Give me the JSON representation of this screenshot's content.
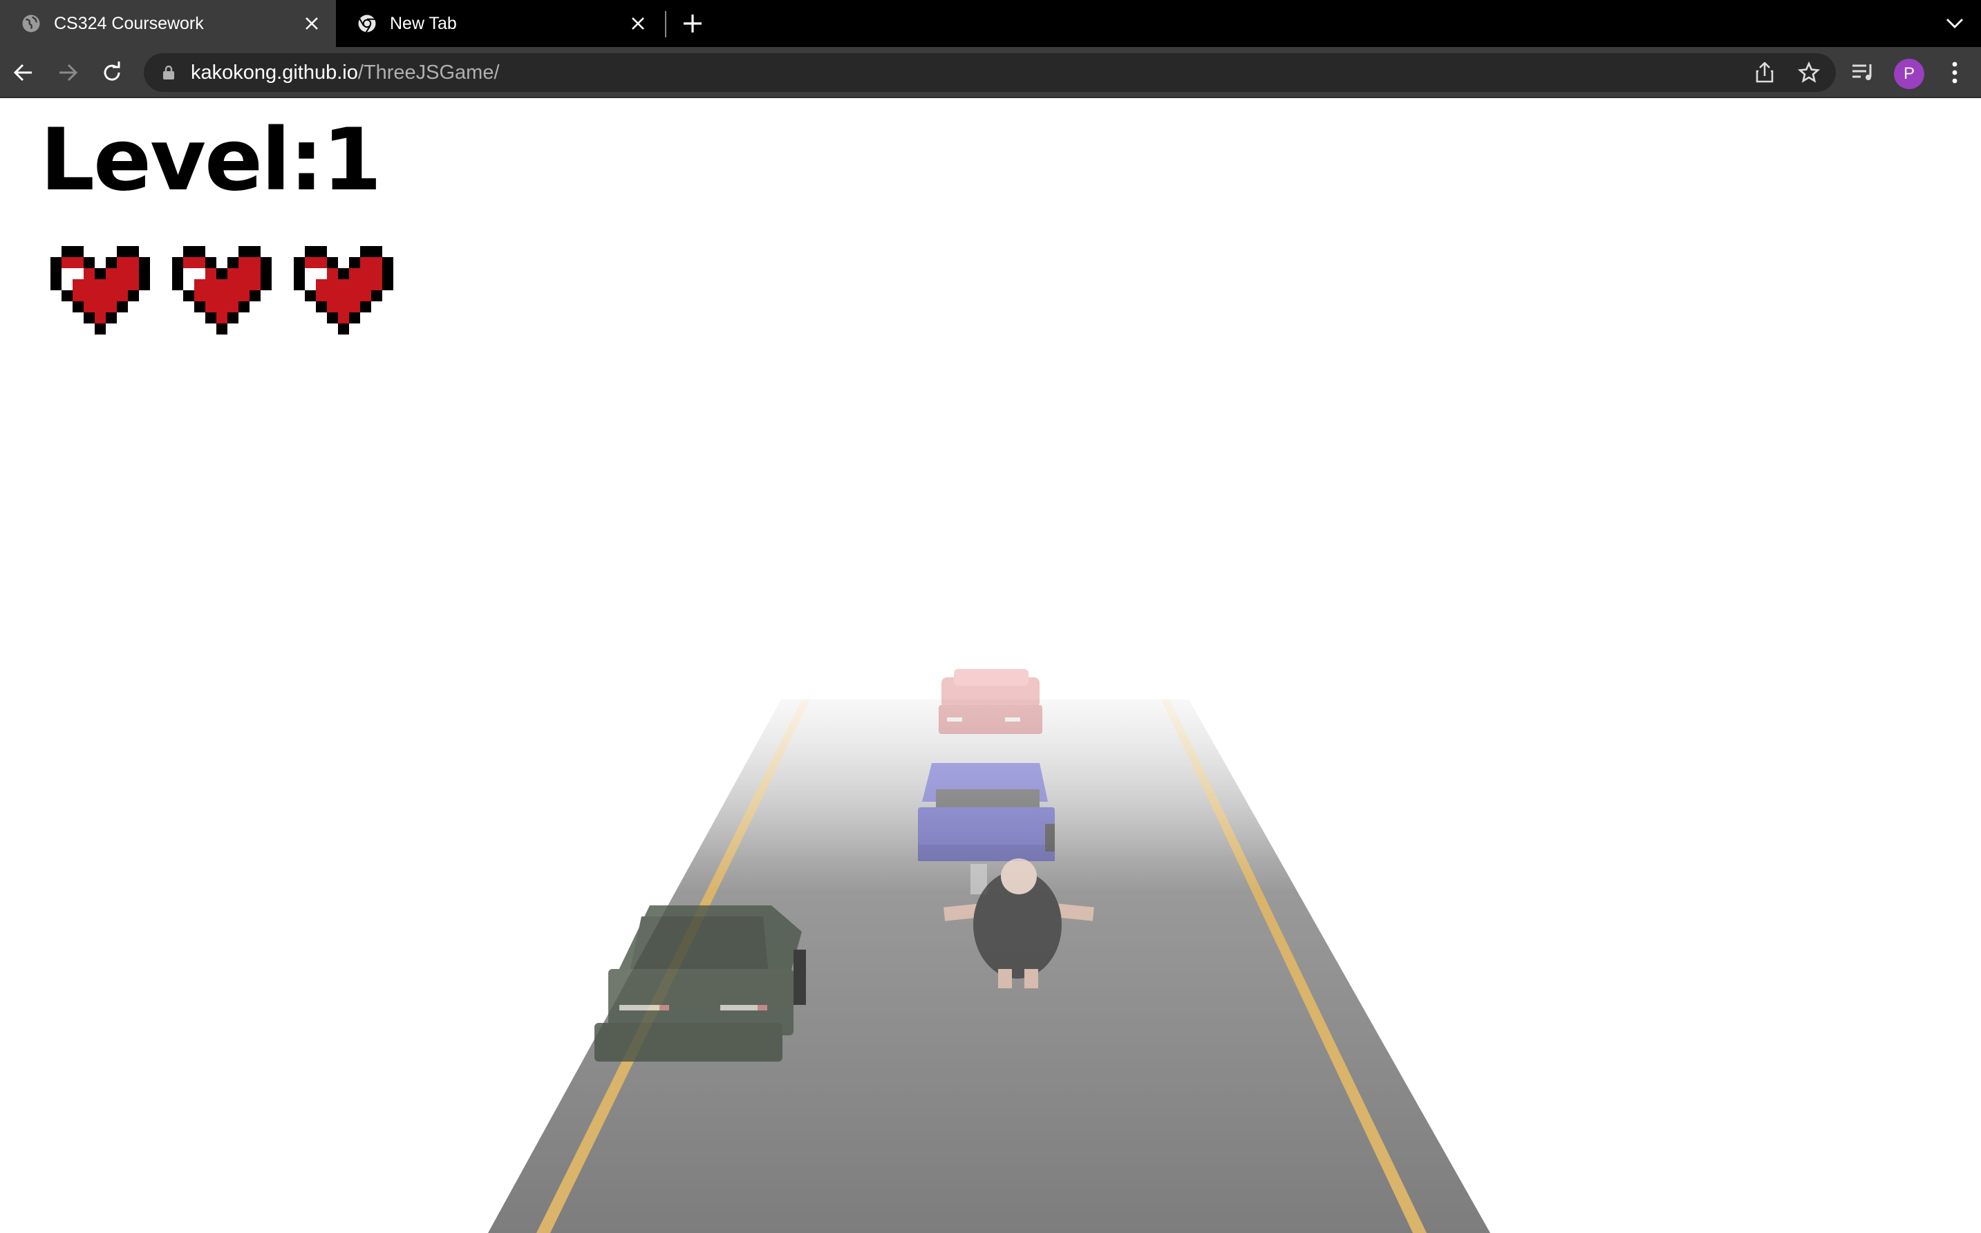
{
  "tabs": [
    {
      "title": "CS324 Coursework",
      "active": true,
      "favicon": "globe-icon"
    },
    {
      "title": "New Tab",
      "active": false,
      "favicon": "chrome-icon"
    }
  ],
  "address": {
    "host": "kakokong.github.io",
    "path": "/ThreeJSGame/"
  },
  "profile": {
    "initial": "P",
    "color": "#9a3fbf"
  },
  "game": {
    "level_label": "Level:1",
    "lives": 3
  },
  "colors": {
    "heart_red": "#c4161c",
    "road": "#8a8a8a",
    "lane_line": "#d9b46a"
  }
}
